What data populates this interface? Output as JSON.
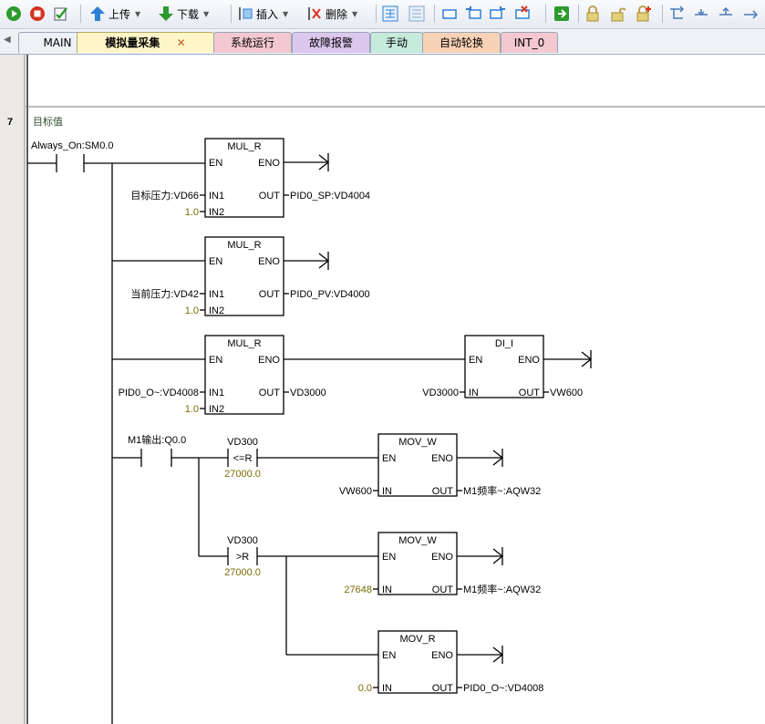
{
  "toolbar": {
    "upload_label": "上传",
    "download_label": "下载",
    "insert_label": "插入",
    "delete_label": "删除"
  },
  "tabs": [
    {
      "label": "MAIN",
      "color": "#eef1f6"
    },
    {
      "label": "模拟量采集",
      "color": "#fff6c8",
      "close": "✕"
    },
    {
      "label": "系统运行",
      "color": "#f4c8cf"
    },
    {
      "label": "故障报警",
      "color": "#dcc8ee"
    },
    {
      "label": "手动",
      "color": "#c6eadc"
    },
    {
      "label": "自动轮换",
      "color": "#f8d2b6"
    },
    {
      "label": "INT_0",
      "color": "#f4c8cf"
    }
  ],
  "network": {
    "number": "7",
    "comment": "目标值"
  },
  "contacts": {
    "always_on": "Always_On:SM0.0",
    "m1_output": "M1输出:Q0.0"
  },
  "boxes": [
    {
      "title": "MUL_R",
      "en": "EN",
      "eno": "ENO",
      "in1": "IN1",
      "in2": "IN2",
      "out": "OUT",
      "in1_val": "目标压力:VD66",
      "in2_val": "1.0",
      "out_val": "PID0_SP:VD4004"
    },
    {
      "title": "MUL_R",
      "en": "EN",
      "eno": "ENO",
      "in1": "IN1",
      "in2": "IN2",
      "out": "OUT",
      "in1_val": "当前压力:VD42",
      "in2_val": "1.0",
      "out_val": "PID0_PV:VD4000"
    },
    {
      "title": "MUL_R",
      "en": "EN",
      "eno": "ENO",
      "in1": "IN1",
      "in2": "IN2",
      "out": "OUT",
      "in1_val": "PID0_O~:VD4008",
      "in2_val": "1.0",
      "out_val": "VD3000"
    },
    {
      "title": "DI_I",
      "en": "EN",
      "eno": "ENO",
      "in": "IN",
      "out": "OUT",
      "in_val": "VD3000",
      "out_val": "VW600"
    },
    {
      "title": "MOV_W",
      "en": "EN",
      "eno": "ENO",
      "in": "IN",
      "out": "OUT",
      "in_val": "VW600",
      "out_val": "M1频率~:AQW32"
    },
    {
      "title": "MOV_W",
      "en": "EN",
      "eno": "ENO",
      "in": "IN",
      "out": "OUT",
      "in_val": "27648",
      "out_val": "M1频率~:AQW32"
    },
    {
      "title": "MOV_R",
      "en": "EN",
      "eno": "ENO",
      "in": "IN",
      "out": "OUT",
      "in_val": "0.0",
      "out_val": "PID0_O~:VD4008"
    }
  ],
  "compares": [
    {
      "operand_a": "VD300",
      "op": "<=R",
      "operand_b": "27000.0"
    },
    {
      "operand_a": "VD300",
      "op": ">R",
      "operand_b": "27000.0"
    }
  ],
  "colors": {
    "constant": "#7a6a00",
    "comment": "#2f4f2f",
    "margin": "#ebeae4"
  }
}
